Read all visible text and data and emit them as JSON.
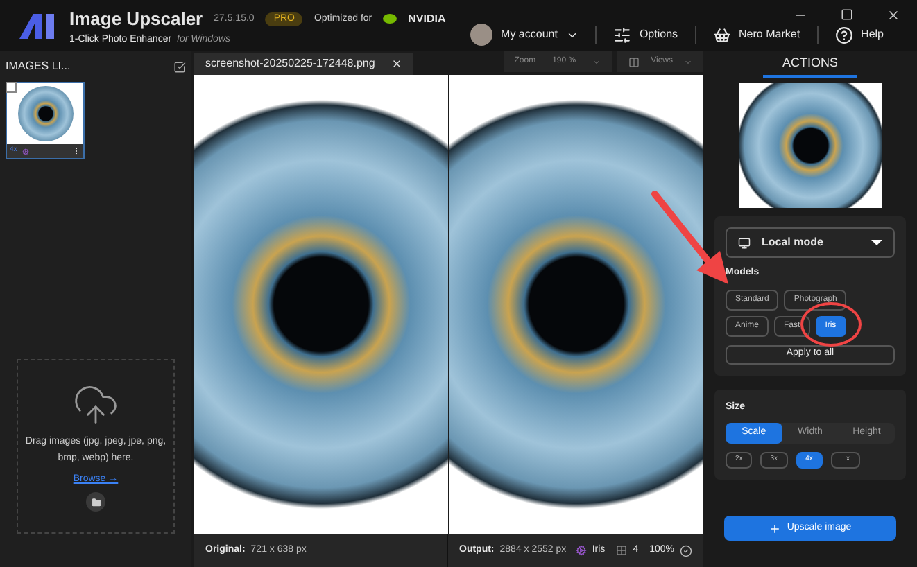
{
  "app": {
    "title": "Image Upscaler",
    "version": "27.5.15.0",
    "badge": "PRO",
    "optimized": "Optimized for",
    "partner": "NVIDIA",
    "subtitle": "1-Click Photo Enhancer",
    "platform": "for Windows"
  },
  "nav": [
    {
      "label": "My account",
      "kind": "account"
    },
    {
      "label": "Options",
      "kind": "options"
    },
    {
      "label": "Nero Market",
      "kind": "market"
    },
    {
      "label": "Help",
      "kind": "help"
    }
  ],
  "sidebar": {
    "title": "IMAGES LI...",
    "thumbnail": {
      "scale": "4x",
      "checked": false
    },
    "drop_text": "Drag images (jpg, jpeg, jpe, png, bmp, webp) here.",
    "browse": "Browse →"
  },
  "viewer": {
    "tab": "screenshot-20250225-172448.png",
    "zoom_label": "Zoom",
    "zoom": "190 %",
    "views": "Views"
  },
  "status": {
    "original_label": "Original:",
    "original": "721 x 638 px",
    "output_label": "Output:",
    "output": "2884 x 2552 px",
    "model": "Iris",
    "count": "4",
    "percent": "100%"
  },
  "actions": {
    "tab": "ACTIONS",
    "mode": "Local mode",
    "models_title": "Models",
    "models": [
      {
        "label": "Standard",
        "selected": false
      },
      {
        "label": "Photograph",
        "selected": false
      },
      {
        "label": "Anime",
        "selected": false
      },
      {
        "label": "Fast",
        "selected": false
      },
      {
        "label": "Iris",
        "selected": true
      }
    ],
    "apply": "Apply to all",
    "size_title": "Size",
    "size_tabs": [
      {
        "label": "Scale",
        "selected": true
      },
      {
        "label": "Width",
        "selected": false
      },
      {
        "label": "Height",
        "selected": false
      }
    ],
    "scales": [
      {
        "label": "2x",
        "selected": false
      },
      {
        "label": "3x",
        "selected": false
      },
      {
        "label": "4x",
        "selected": true
      },
      {
        "label": "...x",
        "selected": false
      }
    ],
    "start": "Upscale image"
  }
}
